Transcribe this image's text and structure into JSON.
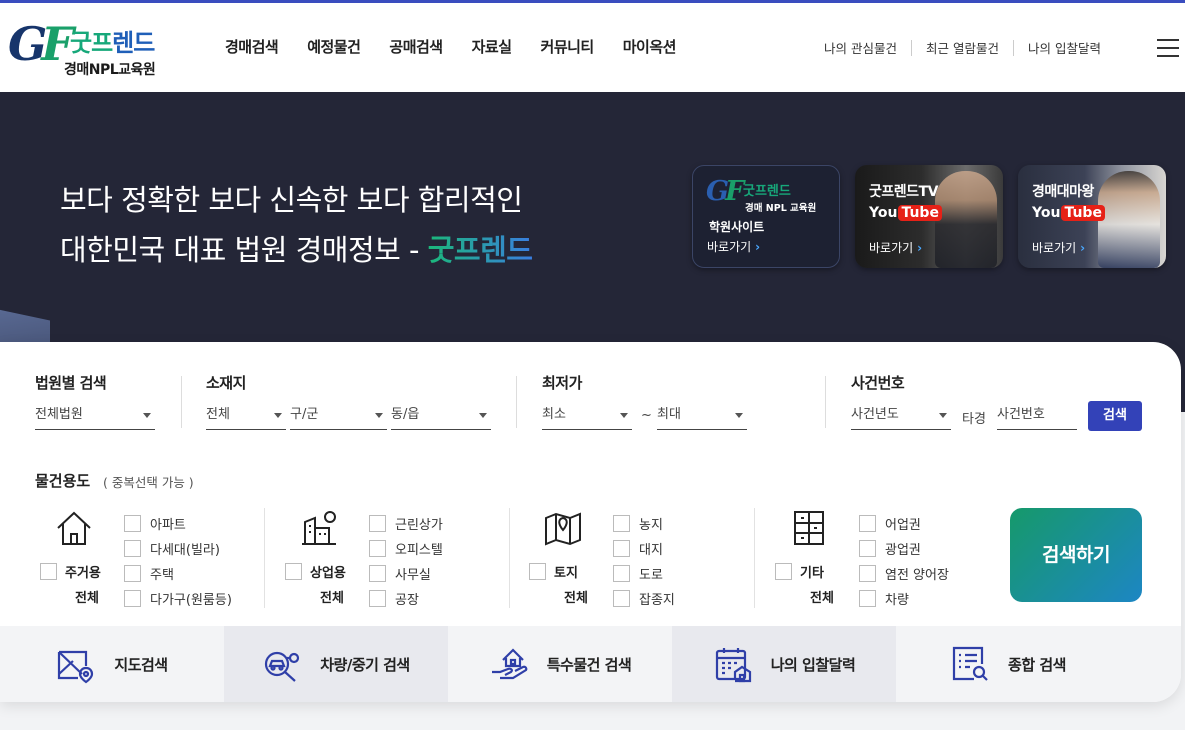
{
  "header": {
    "logo": {
      "mark_g": "G",
      "mark_f": "F",
      "name_part1": "굿프",
      "name_part2": "렌드",
      "sub": "경매NPL교육원"
    },
    "nav": [
      "경매검색",
      "예정물건",
      "공매검색",
      "자료실",
      "커뮤니티",
      "마이옥션"
    ],
    "util": [
      "나의 관심물건",
      "최근 열람물건",
      "나의 입찰달력"
    ]
  },
  "hero": {
    "line1": "보다 정확한 보다 신속한 보다 합리적인",
    "line2_prefix": "대한민국 대표 법원 경매정보 - ",
    "line2_brand": "굿프렌드",
    "tiles": [
      {
        "mini_name": "굿프렌드",
        "mini_sub": "경매 NPL 교육원",
        "title": "학원사이트",
        "go": "바로가기"
      },
      {
        "title": "굿프렌드TV",
        "yt_you": "You",
        "yt_tube": "Tube",
        "go": "바로가기"
      },
      {
        "title": "경매대마왕",
        "yt_you": "You",
        "yt_tube": "Tube",
        "go": "바로가기"
      }
    ]
  },
  "search": {
    "court": {
      "label": "법원별 검색",
      "value": "전체법원"
    },
    "location": {
      "label": "소재지",
      "sido": "전체",
      "gugun": "구/군",
      "dong": "동/읍"
    },
    "price": {
      "label": "최저가",
      "min": "최소",
      "tilde": "~",
      "max": "최대"
    },
    "case": {
      "label": "사건번호",
      "year": "사건년도",
      "ta": "타경",
      "number": "사건번호",
      "button": "검색"
    },
    "usage": {
      "title": "물건용도",
      "note": "( 중복선택 가능 )"
    },
    "categories": [
      {
        "icon": "house-icon",
        "all_label": "주거용",
        "all_sub": "전체",
        "options": [
          "아파트",
          "다세대(빌라)",
          "주택",
          "다가구(원룸등)"
        ]
      },
      {
        "icon": "commercial-building-icon",
        "all_label": "상업용",
        "all_sub": "전체",
        "options": [
          "근린상가",
          "오피스텔",
          "사무실",
          "공장"
        ]
      },
      {
        "icon": "land-map-icon",
        "all_label": "토지",
        "all_sub": "전체",
        "options": [
          "농지",
          "대지",
          "도로",
          "잡종지"
        ]
      },
      {
        "icon": "etc-cabinet-icon",
        "all_label": "기타",
        "all_sub": "전체",
        "options": [
          "어업권",
          "광업권",
          "염전 양어장",
          "차량"
        ]
      }
    ],
    "submit": "검색하기"
  },
  "quick": [
    {
      "icon": "map-search-icon",
      "label": "지도검색"
    },
    {
      "icon": "car-search-icon",
      "label": "차량/중기 검색"
    },
    {
      "icon": "special-property-icon",
      "label": "특수물건 검색"
    },
    {
      "icon": "bid-calendar-icon",
      "label": "나의 입찰달력"
    },
    {
      "icon": "total-search-icon",
      "label": "종합 검색"
    }
  ],
  "colors": {
    "accent": "#3342b8",
    "brand_green": "#17a87a",
    "brand_blue": "#1f5fb8",
    "hero_bg": "#242637"
  }
}
